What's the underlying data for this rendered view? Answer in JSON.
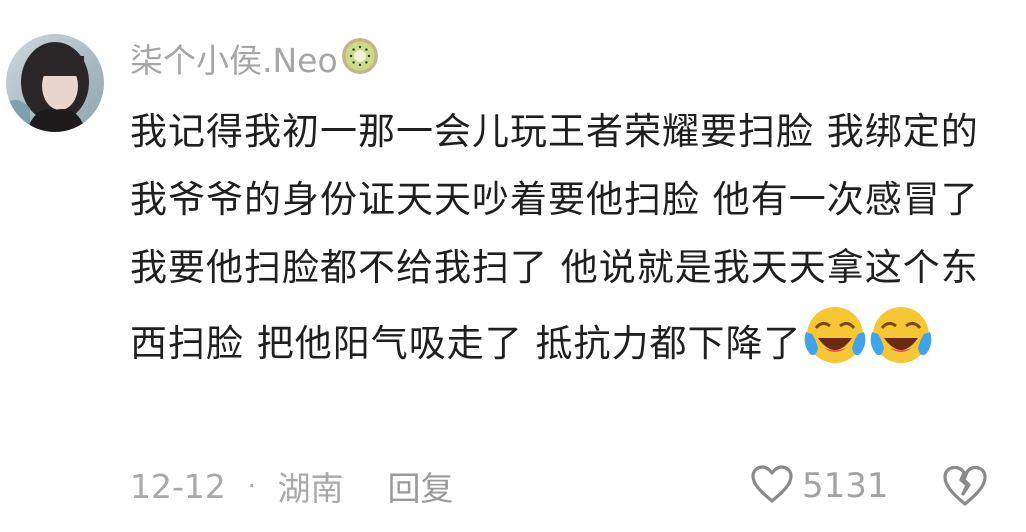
{
  "comment": {
    "username": "柒个小侯.Neo",
    "username_badge_icon": "kiwi-fruit-icon",
    "text": "我记得我初一那一会儿玩王者荣耀要扫脸 我绑定的我爷爷的身份证天天吵着要他扫脸 他有一次感冒了 我要他扫脸都不给我扫了 他说就是我天天拿这个东西扫脸 把他阳气吸走了 抵抗力都下降了",
    "emojis": [
      "laughing-crying-emoji",
      "laughing-crying-emoji"
    ],
    "date": "12-12",
    "separator": "·",
    "location": "湖南",
    "reply_label": "回复",
    "like_count": "5131",
    "like_icon": "heart-outline-icon",
    "dislike_icon": "broken-heart-icon"
  },
  "colors": {
    "meta_text": "#a9a9a9",
    "body_text": "#1f1f1f"
  }
}
